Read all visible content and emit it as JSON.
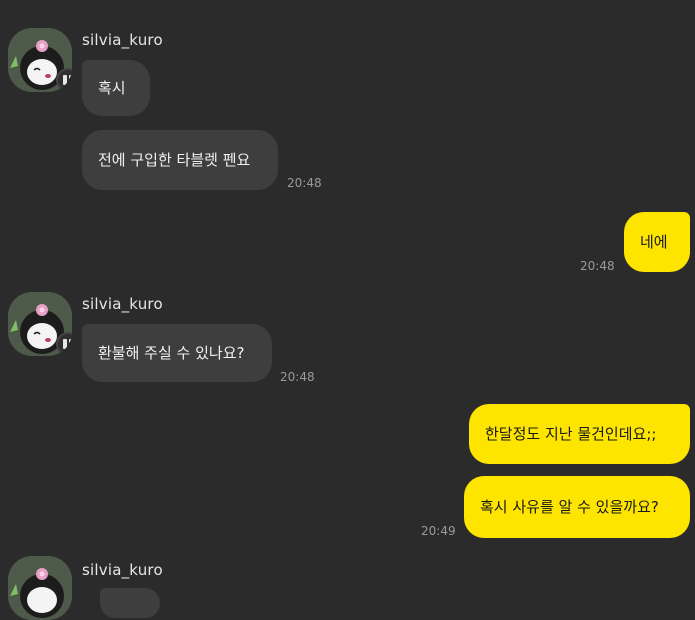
{
  "chat": {
    "messages": [
      {
        "sender": "silvia_kuro",
        "bubbles": [
          "혹시",
          "전에 구입한 타블렛 펜요"
        ],
        "time": "20:48"
      },
      {
        "sender": "me",
        "bubbles": [
          "네에"
        ],
        "time": "20:48"
      },
      {
        "sender": "silvia_kuro",
        "bubbles": [
          "환불해 주실 수 있나요?"
        ],
        "time": "20:48"
      },
      {
        "sender": "me",
        "bubbles": [
          "한달정도 지난 물건인데요;;",
          "혹시 사유를 알 수 있을까요?"
        ],
        "time": "20:49"
      },
      {
        "sender": "silvia_kuro",
        "bubbles": [
          ""
        ],
        "time": ""
      }
    ]
  },
  "colors": {
    "background": "#2b2b2b",
    "incoming_bubble": "#3e3e3e",
    "outgoing_bubble": "#fee500"
  },
  "icons": {
    "avatar": "kuromi-avatar-icon",
    "badge": "profile-badge-icon"
  }
}
